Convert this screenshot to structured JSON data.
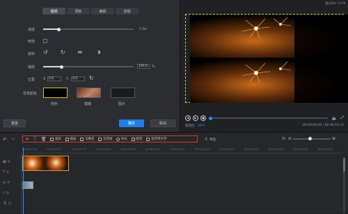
{
  "window": {
    "hint": "最后保存 13:58"
  },
  "tabs": [
    {
      "label": "视频",
      "active": true
    },
    {
      "label": "调色",
      "active": false
    },
    {
      "label": "美颜",
      "active": false
    },
    {
      "label": "音频",
      "active": false
    }
  ],
  "props": {
    "speed_label": "速度",
    "speed_value": "1.0x",
    "speed_level": 0.17,
    "reverse_label": "倒放",
    "rotate_label": "旋转",
    "scale_label": "缩放",
    "scale_value": "100.0",
    "scale_unit": "%",
    "scale_level": 0.2,
    "position_label": "位置",
    "pos_x_label": "X",
    "pos_x": "0.0",
    "pos_y_label": "Y",
    "pos_y": "0.0",
    "bg_label": "背景颜色",
    "bg_options": [
      {
        "label": "纯色"
      },
      {
        "label": "模糊"
      },
      {
        "label": "图片"
      }
    ]
  },
  "actions": {
    "reset": "重置",
    "ok": "确定",
    "cancel": "取消"
  },
  "player": {
    "aspect_label": "宽高比：",
    "aspect_value": "16:9",
    "time": "00:00:00.00 / 00:00:19.72"
  },
  "toolbar": {
    "tools": [
      {
        "label": "裁剪",
        "icon": "crop-icon"
      },
      {
        "label": "缩放",
        "icon": "zoom-icon"
      },
      {
        "label": "马赛克",
        "icon": "mosaic-icon"
      },
      {
        "label": "冻结帧",
        "icon": "freeze-icon"
      },
      {
        "label": "时长",
        "icon": "duration-icon"
      },
      {
        "label": "配音",
        "icon": "mic-icon"
      },
      {
        "label": "语音转文字",
        "icon": "speech-to-text-icon"
      }
    ],
    "export_label": "导出"
  },
  "ruler": [
    "00:00:00.00",
    "00:00:02.00",
    "00:00:04.00",
    "00:00:06.00",
    "00:00:08.00",
    "00:00:10.00",
    "00:00:12.00",
    "00:00:14.00",
    "00:00:16.00",
    "00:00:18.00",
    "00:00:20.00",
    "00:00:22.00",
    "00:00:24.00"
  ],
  "colors": {
    "accent": "#1f7fe6",
    "toolbar_highlight": "#e0392b",
    "playhead": "#2f8fff"
  }
}
